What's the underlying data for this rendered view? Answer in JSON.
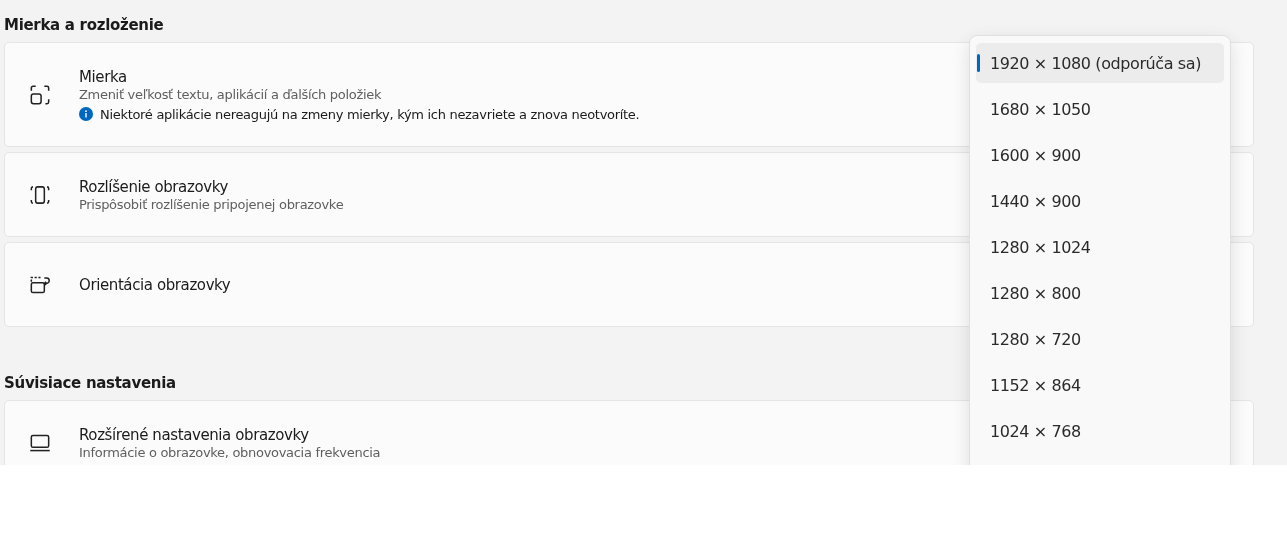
{
  "sections": [
    {
      "heading": "Mierka a rozloženie",
      "items": [
        {
          "kind": "scale",
          "title": "Mierka",
          "subtitle": "Zmeniť veľkosť textu, aplikácií a ďalších položiek",
          "note": "Niektoré aplikácie nereagujú na zmeny mierky, kým ich nezavriete a znova neotvoríte."
        },
        {
          "kind": "resolution",
          "title": "Rozlíšenie obrazovky",
          "subtitle": "Prispôsobiť rozlíšenie pripojenej obrazovke"
        },
        {
          "kind": "orientation",
          "title": "Orientácia obrazovky"
        }
      ]
    },
    {
      "heading": "Súvisiace nastavenia",
      "items": [
        {
          "kind": "laptop",
          "title": "Rozšírené nastavenia obrazovky",
          "subtitle": "Informácie o obrazovke, obnovovacia frekvencia"
        }
      ]
    }
  ],
  "resolution_menu": [
    {
      "label": "1920 × 1080 (odporúča sa)",
      "selected": true
    },
    {
      "label": "1680 × 1050",
      "selected": false
    },
    {
      "label": "1600 × 900",
      "selected": false
    },
    {
      "label": "1440 × 900",
      "selected": false
    },
    {
      "label": "1280 × 1024",
      "selected": false
    },
    {
      "label": "1280 × 800",
      "selected": false
    },
    {
      "label": "1280 × 720",
      "selected": false
    },
    {
      "label": "1152 × 864",
      "selected": false
    },
    {
      "label": "1024 × 768",
      "selected": false
    }
  ]
}
